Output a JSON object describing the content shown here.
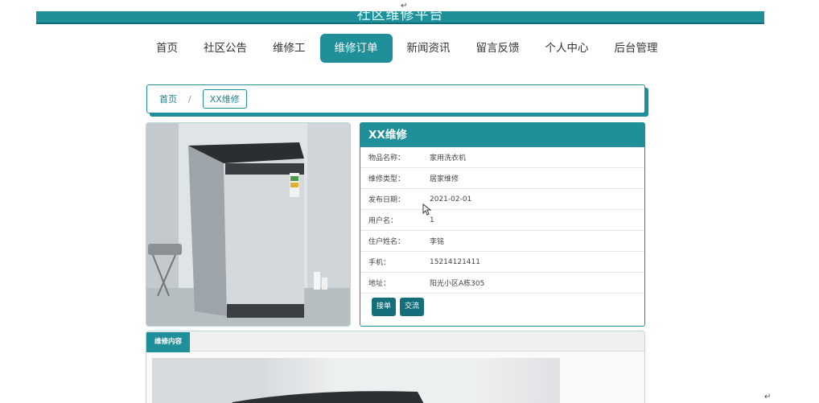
{
  "header": {
    "site_title": "社区维修平台"
  },
  "nav": {
    "items": [
      {
        "label": "首页"
      },
      {
        "label": "社区公告"
      },
      {
        "label": "维修工"
      },
      {
        "label": "维修订单"
      },
      {
        "label": "新闻资讯"
      },
      {
        "label": "留言反馈"
      },
      {
        "label": "个人中心"
      },
      {
        "label": "后台管理"
      }
    ],
    "active_index": 3
  },
  "breadcrumb": {
    "home": "首页",
    "separator": "/",
    "current": "XX维修"
  },
  "details": {
    "title": "XX维修",
    "rows": [
      {
        "label": "物品名称：",
        "value": "家用洗衣机"
      },
      {
        "label": "维修类型：",
        "value": "居家维修"
      },
      {
        "label": "发布日期：",
        "value": "2021-02-01"
      },
      {
        "label": "用户名：",
        "value": "1"
      },
      {
        "label": "住户姓名：",
        "value": "李铭"
      },
      {
        "label": "手机：",
        "value": "15214121411"
      },
      {
        "label": "地址：",
        "value": "阳光小区A栋305"
      }
    ],
    "buttons": {
      "accept": "接单",
      "chat": "交流"
    }
  },
  "content": {
    "tab_label": "维修内容"
  },
  "colors": {
    "accent": "#1f8f9a",
    "accent_dark": "#156f7a"
  },
  "icons": {
    "product_image": "washing-machine-image",
    "cursor": "mouse-cursor-icon",
    "paragraph_mark": "return-arrow-icon"
  }
}
